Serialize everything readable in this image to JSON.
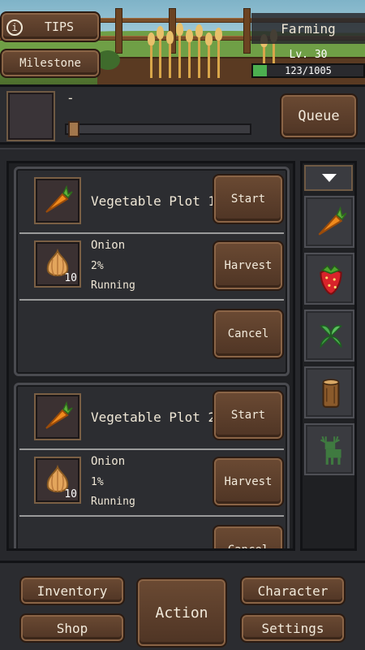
{
  "header": {
    "tips_label": "TIPS",
    "milestone_label": "Milestone",
    "skill": {
      "name": "Farming",
      "level_text": "Lv. 30",
      "xp_text": "123/1005",
      "xp_fraction": 0.122
    }
  },
  "queue": {
    "current_name": "-",
    "button_label": "Queue",
    "progress_fraction": 0.0
  },
  "plots": [
    {
      "title": "Vegetable Plot 1",
      "plot_icon": "carrot-icon",
      "start_label": "Start",
      "crop": {
        "name": "Onion",
        "quantity": "10",
        "percent": "2%",
        "status": "Running",
        "icon": "onion-icon"
      },
      "harvest_label": "Harvest",
      "cancel_label": "Cancel"
    },
    {
      "title": "Vegetable Plot 2",
      "plot_icon": "carrot-icon",
      "start_label": "Start",
      "crop": {
        "name": "Onion",
        "quantity": "10",
        "percent": "1%",
        "status": "Running",
        "icon": "onion-icon"
      },
      "harvest_label": "Harvest",
      "cancel_label": "Cancel"
    }
  ],
  "categories": [
    "carrot-icon",
    "strawberry-icon",
    "herb-icon",
    "log-icon",
    "deer-icon"
  ],
  "nav": {
    "inventory": "Inventory",
    "shop": "Shop",
    "action": "Action",
    "character": "Character",
    "settings": "Settings"
  },
  "colors": {
    "wood_button": "#5c3f2c",
    "xp_bar": "#4caf50",
    "panel_bg": "#27282c"
  }
}
